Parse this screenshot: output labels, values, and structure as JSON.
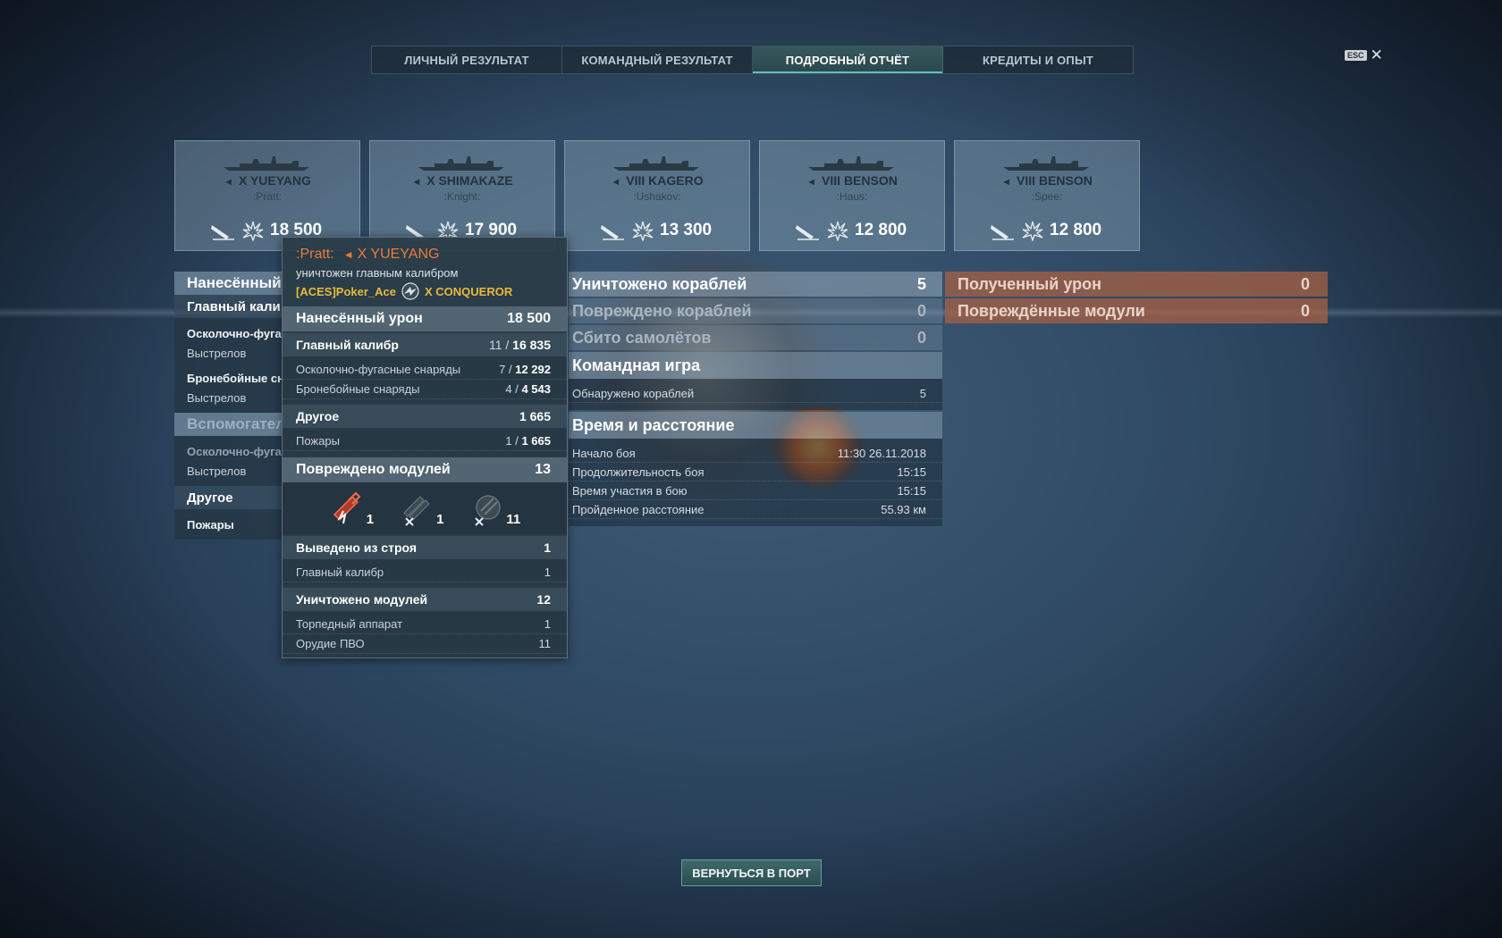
{
  "tabs": [
    {
      "label": "ЛИЧНЫЙ РЕЗУЛЬТАТ"
    },
    {
      "label": "КОМАНДНЫЙ РЕЗУЛЬТАТ"
    },
    {
      "label": "ПОДРОБНЫЙ ОТЧЁТ"
    },
    {
      "label": "КРЕДИТЫ И ОПЫТ"
    }
  ],
  "active_tab": "ПОДРОБНЫЙ ОТЧЁТ",
  "esc_key": "ESC",
  "close_glyph": "✕",
  "ship_cards": [
    {
      "ship": "X YUEYANG",
      "player": ":Pratt:",
      "damage": "18 500"
    },
    {
      "ship": "X SHIMAKAZE",
      "player": ":Knight:",
      "damage": "17 900"
    },
    {
      "ship": "VIII KAGERO",
      "player": ":Ushakov:",
      "damage": "13 300"
    },
    {
      "ship": "VIII BENSON",
      "player": ":Haus:",
      "damage": "12 800"
    },
    {
      "ship": "VIII BENSON",
      "player": ":Spee:",
      "damage": "12 800"
    }
  ],
  "left_panel": {
    "dealt": "Нанесённый",
    "main": "Главный кали",
    "he": "Осколочно-фугасн",
    "shots1": "Выстрелов",
    "ap": "Бронебойные снар",
    "shots2": "Выстрелов",
    "secondary": "Вспомогатель",
    "he2": "Осколочно-фугасн",
    "shots3": "Выстрелов",
    "other": "Другое",
    "fires": "Пожары"
  },
  "middle_panel": {
    "destroyed_ships": {
      "label": "Уничтожено кораблей",
      "value": "5"
    },
    "damaged_ships": {
      "label": "Повреждено кораблей",
      "value": "0"
    },
    "planes": {
      "label": "Сбито самолётов",
      "value": "0"
    },
    "team_play": "Командная игра",
    "spotted": {
      "label": "Обнаружено кораблей",
      "value": "5"
    },
    "time_distance": "Время и расстояние",
    "battle_start": {
      "label": "Начало боя",
      "value": "11:30  26.11.2018"
    },
    "duration": {
      "label": "Продолжительность боя",
      "value": "15:15"
    },
    "participation": {
      "label": "Время участия в бою",
      "value": "15:15"
    },
    "distance": {
      "label": "Пройденное расстояние",
      "value": "55.93 км"
    }
  },
  "right_panel": {
    "received": {
      "label": "Полученный урон",
      "value": "0"
    },
    "modules": {
      "label": "Повреждённые модули",
      "value": "0"
    }
  },
  "tooltip": {
    "player": ":Pratt:",
    "ship": "X YUEYANG",
    "killed_by": "уничтожен главным калибром",
    "killer_player": "[ACES]Poker_Ace",
    "killer_ship": "X CONQUEROR",
    "dealt": {
      "label": "Нанесённый урон",
      "value": "18 500"
    },
    "main": {
      "label": "Главный калибр",
      "hits": "11 /",
      "dmg": "16 835"
    },
    "he": {
      "label": "Осколочно-фугасные снаряды",
      "hits": "7 /",
      "dmg": "12 292"
    },
    "ap": {
      "label": "Бронебойные снаряды",
      "hits": "4 /",
      "dmg": "4 543"
    },
    "other": {
      "label": "Другое",
      "value": "1 665"
    },
    "fires": {
      "label": "Пожары",
      "hits": "1 /",
      "dmg": "1 665"
    },
    "modules_damaged": {
      "label": "Повреждено модулей",
      "value": "13"
    },
    "module_icons": [
      {
        "icon": "main-battery-incapacitated-icon",
        "count": "1"
      },
      {
        "icon": "torpedo-tubes-destroyed-icon",
        "count": "1"
      },
      {
        "icon": "aa-guns-destroyed-icon",
        "count": "11"
      }
    ],
    "incapacitated": {
      "label": "Выведено из строя",
      "value": "1"
    },
    "inc_main": {
      "label": "Главный калибр",
      "value": "1"
    },
    "modules_destroyed": {
      "label": "Уничтожено модулей",
      "value": "12"
    },
    "torpedo": {
      "label": "Торпедный аппарат",
      "value": "1"
    },
    "aa": {
      "label": "Орудие ПВО",
      "value": "11"
    }
  },
  "return_button": "ВЕРНУТЬСЯ В ПОРТ"
}
